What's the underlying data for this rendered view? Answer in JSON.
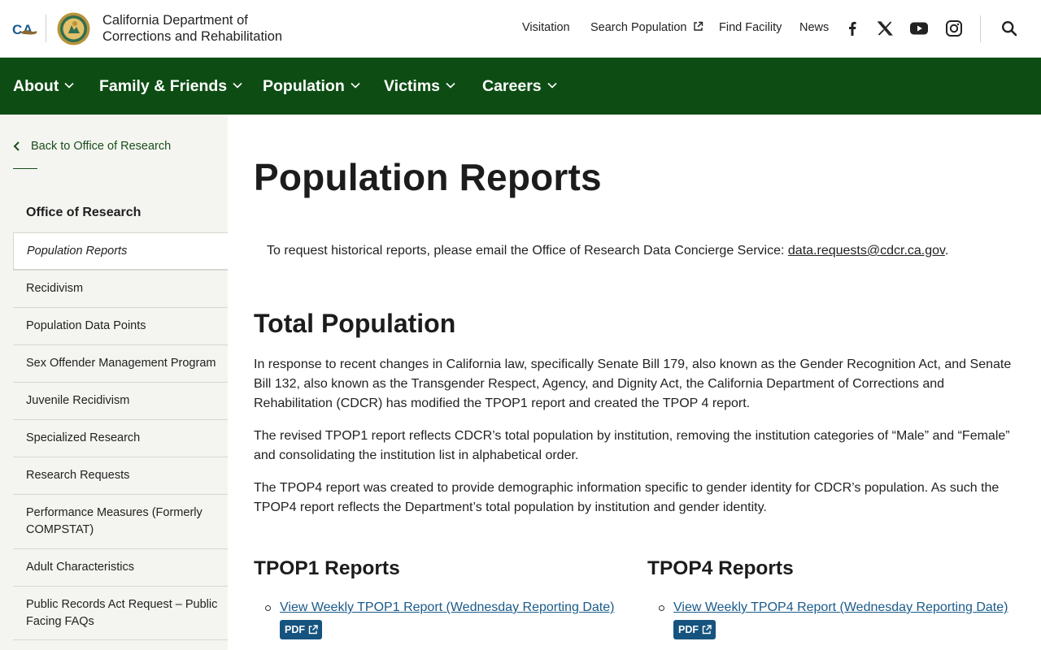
{
  "header": {
    "ca_logo_text": "CA",
    "dept_name_line1": "California Department of",
    "dept_name_line2": "Corrections and Rehabilitation",
    "utility_links": [
      "Visitation",
      "Search Population",
      "Find Facility",
      "News"
    ],
    "social_icons": [
      "facebook-icon",
      "x-icon",
      "youtube-icon",
      "instagram-icon"
    ]
  },
  "main_nav": [
    "About",
    "Family & Friends",
    "Population",
    "Victims",
    "Careers"
  ],
  "sidebar": {
    "back_label": "Back to Office of Research",
    "heading": "Office of Research",
    "items": [
      "Population Reports",
      "Recidivism",
      "Population Data Points",
      "Sex Offender Management Program",
      "Juvenile Recidivism",
      "Specialized Research",
      "Research Requests",
      "Performance Measures (Formerly COMPSTAT)",
      "Adult Characteristics",
      "Public Records Act Request – Public Facing FAQs"
    ],
    "active_index": 0
  },
  "content": {
    "page_title": "Population Reports",
    "request_text": "To request historical reports, please email the Office of Research Data Concierge Service: ",
    "request_email": "data.requests@cdcr.ca.gov",
    "request_end": ".",
    "section_title": "Total Population",
    "paragraphs": [
      "In response to recent changes in California law, specifically Senate Bill 179, also known as the Gender Recognition Act, and Senate Bill 132, also known as the Transgender Respect, Agency, and Dignity Act, the California Department of Corrections and Rehabilitation (CDCR) has modified the TPOP1 report and created the TPOP 4 report.",
      "The revised TPOP1 report reflects CDCR’s total population by institution, removing the institution categories of “Male” and “Female” and consolidating the institution list in alphabetical order.",
      "The TPOP4 report was created to provide demographic information specific to gender identity for CDCR’s population. As such the TPOP4 report reflects the Department’s total population by institution and gender identity."
    ],
    "tpop1": {
      "heading": "TPOP1 Reports",
      "link": "View Weekly TPOP1 Report (Wednesday Reporting Date)",
      "badge": "PDF"
    },
    "tpop4": {
      "heading": "TPOP4 Reports",
      "link": "View Weekly TPOP4 Report (Wednesday Reporting Date)",
      "badge": "PDF"
    }
  },
  "colors": {
    "nav_green": "#0d4d14",
    "sidebar_bg": "#f4f5f0",
    "link_blue": "#1a5a8a",
    "badge_blue": "#16547f"
  }
}
